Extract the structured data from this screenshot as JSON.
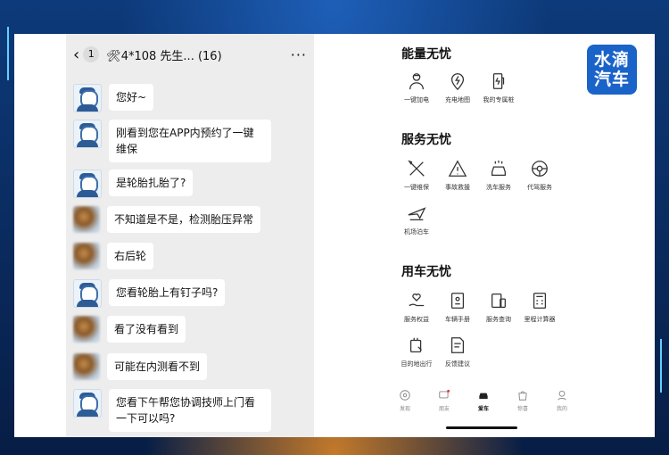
{
  "chat": {
    "back_badge": "1",
    "title": "🛠4*108 先生... (16)",
    "more": "···",
    "messages": [
      {
        "sender": "agent",
        "text": "您好~"
      },
      {
        "sender": "agent",
        "text": "刚看到您在APP内预约了一键维保"
      },
      {
        "sender": "agent",
        "text": "是轮胎扎胎了?"
      },
      {
        "sender": "customer",
        "text": "不知道是不是，检测胎压异常"
      },
      {
        "sender": "customer",
        "text": "右后轮"
      },
      {
        "sender": "agent",
        "text": "您看轮胎上有钉子吗?"
      },
      {
        "sender": "customer",
        "text": "看了没有看到"
      },
      {
        "sender": "customer",
        "text": "可能在内测看不到"
      },
      {
        "sender": "agent",
        "text": "您看下午帮您协调技师上门看一下可以吗?"
      }
    ]
  },
  "app": {
    "sections": [
      {
        "title": "能量无忧",
        "items": [
          {
            "label": "一键加电",
            "icon": "worker-icon"
          },
          {
            "label": "充电地图",
            "icon": "map-pin-icon"
          },
          {
            "label": "我的专属桩",
            "icon": "charger-icon"
          }
        ]
      },
      {
        "title": "服务无忧",
        "items": [
          {
            "label": "一键维保",
            "icon": "tools-icon"
          },
          {
            "label": "事故救援",
            "icon": "warning-icon"
          },
          {
            "label": "洗车服务",
            "icon": "car-wash-icon"
          },
          {
            "label": "代驾服务",
            "icon": "steering-wheel-icon"
          },
          {
            "label": "机场泊车",
            "icon": "plane-icon"
          }
        ]
      },
      {
        "title": "用车无忧",
        "items": [
          {
            "label": "服务权益",
            "icon": "hand-heart-icon"
          },
          {
            "label": "车辆手册",
            "icon": "manual-icon"
          },
          {
            "label": "服务查询",
            "icon": "search-doc-icon"
          },
          {
            "label": "里程计算器",
            "icon": "calculator-icon"
          },
          {
            "label": "目的地出行",
            "icon": "destination-icon"
          },
          {
            "label": "反馈建议",
            "icon": "feedback-icon"
          }
        ]
      }
    ],
    "tabs": [
      {
        "label": "发现",
        "icon": "compass-icon"
      },
      {
        "label": "朋友",
        "icon": "chat-icon"
      },
      {
        "label": "爱车",
        "icon": "car-icon"
      },
      {
        "label": "惊喜",
        "icon": "bag-icon"
      },
      {
        "label": "我的",
        "icon": "person-icon"
      }
    ],
    "active_tab": "爱车"
  },
  "logo": {
    "line1": "水滴",
    "line2": "汽车"
  },
  "colors": {
    "logo_bg": "#1a63c9",
    "frame": "#5fd0ff",
    "chat_bg": "#ededed"
  }
}
